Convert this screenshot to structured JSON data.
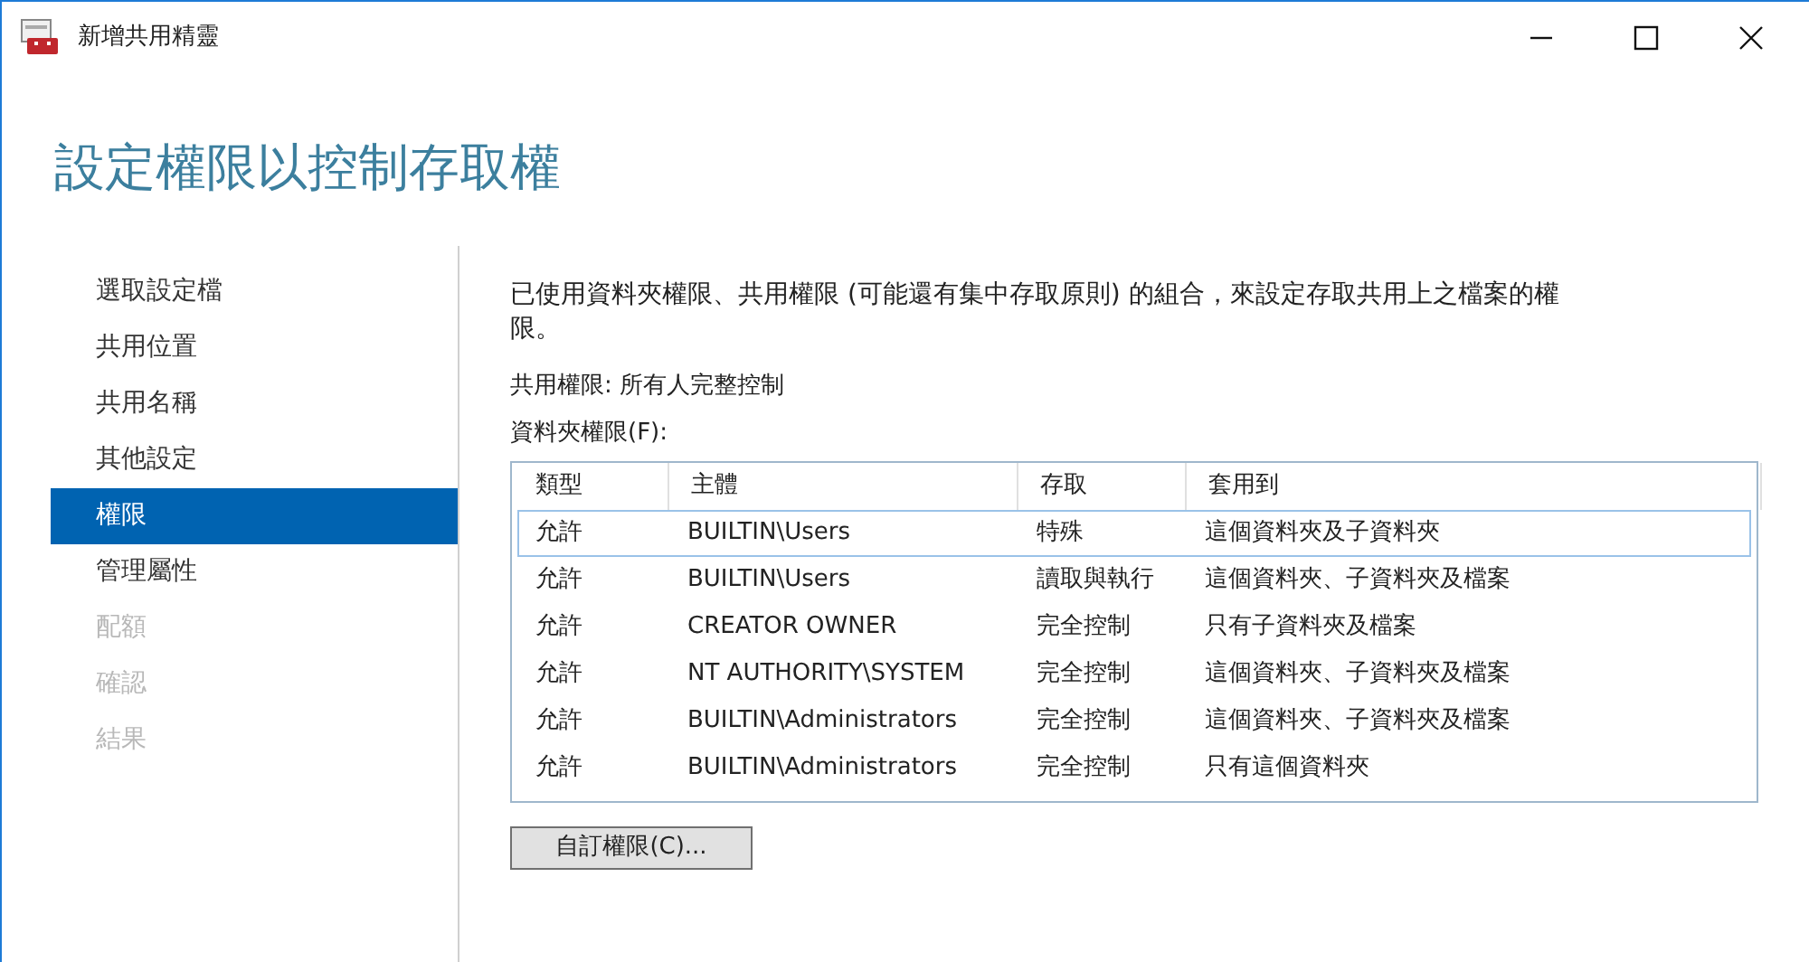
{
  "window": {
    "title": "新增共用精靈"
  },
  "heading": "設定權限以控制存取權",
  "sidebar": {
    "items": [
      {
        "label": "選取設定檔",
        "selected": false,
        "disabled": false
      },
      {
        "label": "共用位置",
        "selected": false,
        "disabled": false
      },
      {
        "label": "共用名稱",
        "selected": false,
        "disabled": false
      },
      {
        "label": "其他設定",
        "selected": false,
        "disabled": false
      },
      {
        "label": "權限",
        "selected": true,
        "disabled": false
      },
      {
        "label": "管理屬性",
        "selected": false,
        "disabled": false
      },
      {
        "label": "配額",
        "selected": false,
        "disabled": true
      },
      {
        "label": "確認",
        "selected": false,
        "disabled": true
      },
      {
        "label": "結果",
        "selected": false,
        "disabled": true
      }
    ]
  },
  "description": "已使用資料夾權限、共用權限 (可能還有集中存取原則) 的組合，來設定存取共用上之檔案的權限。",
  "share_permissions": "共用權限: 所有人完整控制",
  "folder_permissions_label": "資料夾權限(F):",
  "table": {
    "columns": [
      "類型",
      "主體",
      "存取",
      "套用到"
    ],
    "rows": [
      {
        "cells": [
          "允許",
          "BUILTIN\\Users",
          "特殊",
          "這個資料夾及子資料夾"
        ],
        "selected": true
      },
      {
        "cells": [
          "允許",
          "BUILTIN\\Users",
          "讀取與執行",
          "這個資料夾、子資料夾及檔案"
        ],
        "selected": false
      },
      {
        "cells": [
          "允許",
          "CREATOR OWNER",
          "完全控制",
          "只有子資料夾及檔案"
        ],
        "selected": false
      },
      {
        "cells": [
          "允許",
          "NT AUTHORITY\\SYSTEM",
          "完全控制",
          "這個資料夾、子資料夾及檔案"
        ],
        "selected": false
      },
      {
        "cells": [
          "允許",
          "BUILTIN\\Administrators",
          "完全控制",
          "這個資料夾、子資料夾及檔案"
        ],
        "selected": false
      },
      {
        "cells": [
          "允許",
          "BUILTIN\\Administrators",
          "完全控制",
          "只有這個資料夾"
        ],
        "selected": false
      }
    ]
  },
  "buttons": [
    "自訂權限(C)..."
  ]
}
